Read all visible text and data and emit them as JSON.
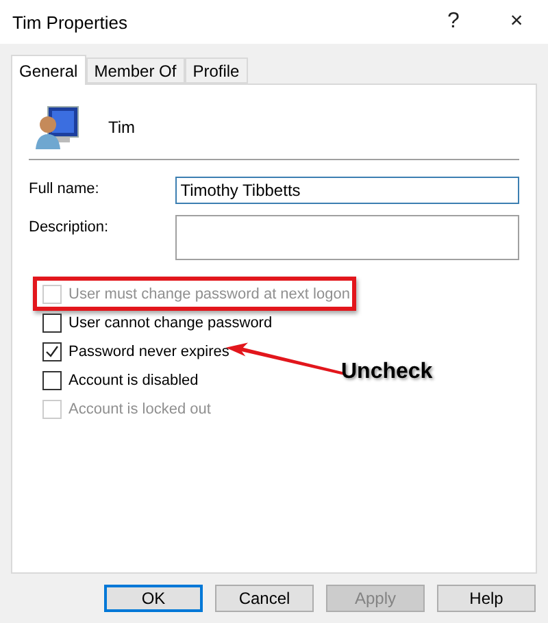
{
  "window": {
    "title": "Tim Properties",
    "help_button": "?",
    "close_button": "×"
  },
  "tabs": [
    {
      "label": "General",
      "selected": true
    },
    {
      "label": "Member Of",
      "selected": false
    },
    {
      "label": "Profile",
      "selected": false
    }
  ],
  "user": {
    "name": "Tim"
  },
  "fields": [
    {
      "label": "Full name:",
      "value": "Timothy Tibbetts",
      "kind": "single"
    },
    {
      "label": "Description:",
      "kind": "multi"
    }
  ],
  "checkboxes": [
    {
      "label": "User must change password at next logon",
      "checked": false,
      "disabled": true,
      "highlighted": true,
      "pointed_at": false
    },
    {
      "label": "User cannot change password",
      "checked": false,
      "disabled": false,
      "highlighted": false,
      "pointed_at": false
    },
    {
      "label": "Password never expires",
      "checked": true,
      "disabled": false,
      "highlighted": false,
      "pointed_at": true
    },
    {
      "label": "Account is disabled",
      "checked": false,
      "disabled": false,
      "highlighted": false,
      "pointed_at": false
    },
    {
      "label": "Account is locked out",
      "checked": false,
      "disabled": true,
      "highlighted": false,
      "pointed_at": false
    }
  ],
  "callout": {
    "label": "Uncheck"
  },
  "buttons": [
    {
      "label": "OK",
      "default": true,
      "disabled": false
    },
    {
      "label": "Cancel",
      "default": false,
      "disabled": false
    },
    {
      "label": "Apply",
      "default": false,
      "disabled": true
    },
    {
      "label": "Help",
      "default": false,
      "disabled": false
    }
  ]
}
